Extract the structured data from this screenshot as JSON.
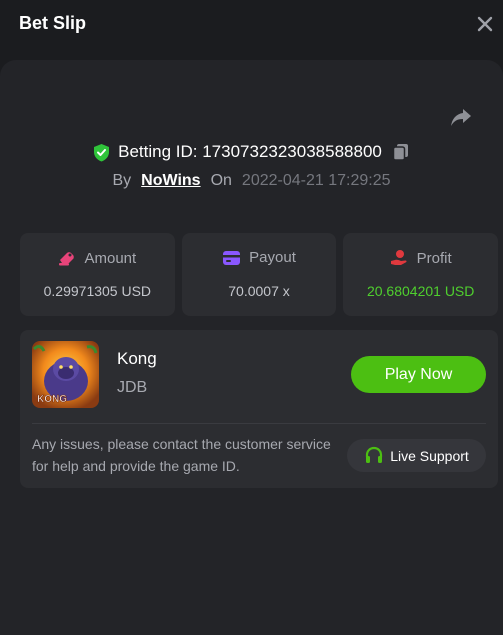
{
  "header": {
    "title": "Bet Slip"
  },
  "bet": {
    "betting_id_label": "Betting ID: 1730732323038588800",
    "by_label": "By",
    "user": "NoWins",
    "on_label": "On",
    "datetime": "2022-04-21 17:29:25"
  },
  "stats": [
    {
      "label": "Amount",
      "value": "0.29971305 USD",
      "icon": "amount-icon",
      "color": "#e8447a"
    },
    {
      "label": "Payout",
      "value": "70.0007 x",
      "icon": "card-icon",
      "color": "#8a57ff"
    },
    {
      "label": "Profit",
      "value": "20.6804201 USD",
      "icon": "profit-icon",
      "color": "#e0393e"
    }
  ],
  "game": {
    "name": "Kong",
    "provider": "JDB",
    "thumb_text": "KONG",
    "play_label": "Play Now"
  },
  "support": {
    "notice": "Any issues, please contact the customer service for help and provide the game ID.",
    "button_label": "Live Support"
  },
  "colors": {
    "accent_green": "#4cbf12",
    "profit_green": "#4fcf2e",
    "shield_green": "#2fc43a"
  }
}
